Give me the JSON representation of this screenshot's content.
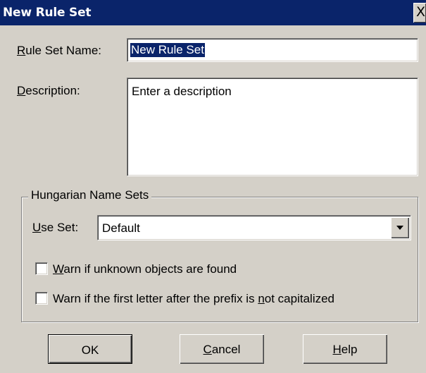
{
  "window": {
    "title": "New Rule Set",
    "close_glyph": "X",
    "close_icon": "close-icon"
  },
  "rule_set_name": {
    "label_mnemonic": "R",
    "label_rest": "ule Set Name:",
    "value": "New Rule Set"
  },
  "description": {
    "label_mnemonic": "D",
    "label_rest": "escription:",
    "value": "Enter a description"
  },
  "hungarian_name_sets": {
    "group_label": "Hungarian Name Sets",
    "use_set": {
      "label_mnemonic": "U",
      "label_rest": "se Set:",
      "selected": "Default",
      "dropdown_icon": "chevron-down-icon"
    },
    "options": [
      {
        "before": "",
        "mnemonic": "W",
        "after": "arn if unknown objects are found",
        "checked": false
      },
      {
        "before": "Warn if the first letter after the prefix is ",
        "mnemonic": "n",
        "after": "ot capitalized",
        "checked": false
      }
    ]
  },
  "buttons": {
    "ok": {
      "label": "OK"
    },
    "cancel": {
      "mnemonic": "C",
      "label_rest": "ancel"
    },
    "help": {
      "mnemonic": "H",
      "label_rest": "elp"
    }
  },
  "colors": {
    "titlebar": "#0a246a",
    "dialog_face": "#d4d0c8",
    "field_bg": "#ffffff",
    "selection": "#0a246a"
  }
}
